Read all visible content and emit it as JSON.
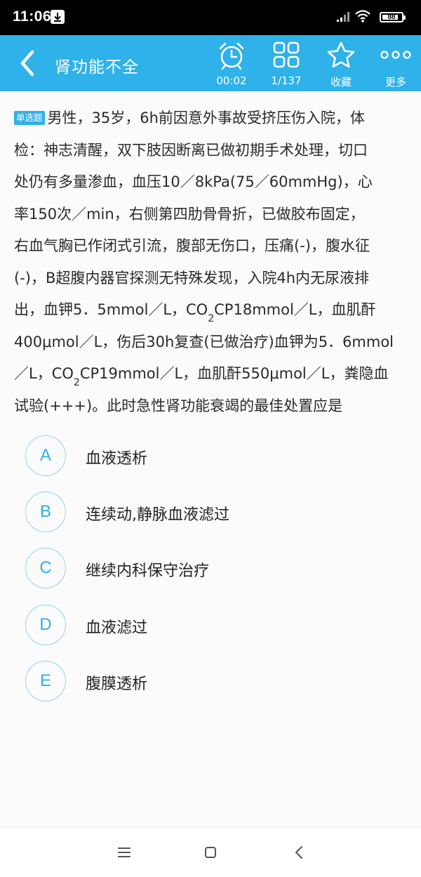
{
  "status_bar": {
    "time": "11:06",
    "battery_text": "88",
    "battery_level": 0.88,
    "icons": [
      "download-icon",
      "signal-icon",
      "wifi-icon",
      "battery-icon"
    ]
  },
  "header": {
    "title": "肾功能不全",
    "timer_label": "00:02",
    "progress_label": "1/137",
    "favorite_label": "收藏",
    "more_label": "更多",
    "accent_color": "#2fb1e9"
  },
  "question": {
    "type_badge": "单选题",
    "lines": [
      "男性，35岁，6h前因意外事故受挤压伤入院，体",
      "检：神志清醒，双下肢因断离已做初期手术处理，切口",
      "处仍有多量渗血，血压10／8kPa(75／60mmHg)，心",
      "率150次／min，右侧第四肋骨骨折，已做胶布固定，",
      "右血气胸已作闭式引流，腹部无伤口，压痛(-)，腹水征",
      "(-)，B超腹内器官探测无特殊发现，入院4h内无尿液排"
    ],
    "line7_a": "出，血钾5．5mmol／L，CO",
    "line7_sub": "2",
    "line7_b": "CP18mmol／L，血肌酐",
    "line8": "400μmol／L，伤后30h复查(已做治疗)血钾为5．6mmol",
    "line9_a": "／L，CO",
    "line9_sub": "2",
    "line9_b": "CP19mmol／L，血肌酐550μmol／L，粪隐血",
    "line10": "试验(+++)。此时急性肾功能衰竭的最佳处置应是"
  },
  "options": [
    {
      "letter": "A",
      "text": "血液透析"
    },
    {
      "letter": "B",
      "text": "连续动,静脉血液滤过"
    },
    {
      "letter": "C",
      "text": "继续内科保守治疗"
    },
    {
      "letter": "D",
      "text": "血液滤过"
    },
    {
      "letter": "E",
      "text": "腹膜透析"
    }
  ],
  "nav_bar": {
    "icons": [
      "menu-icon",
      "home-icon",
      "back-icon"
    ]
  }
}
